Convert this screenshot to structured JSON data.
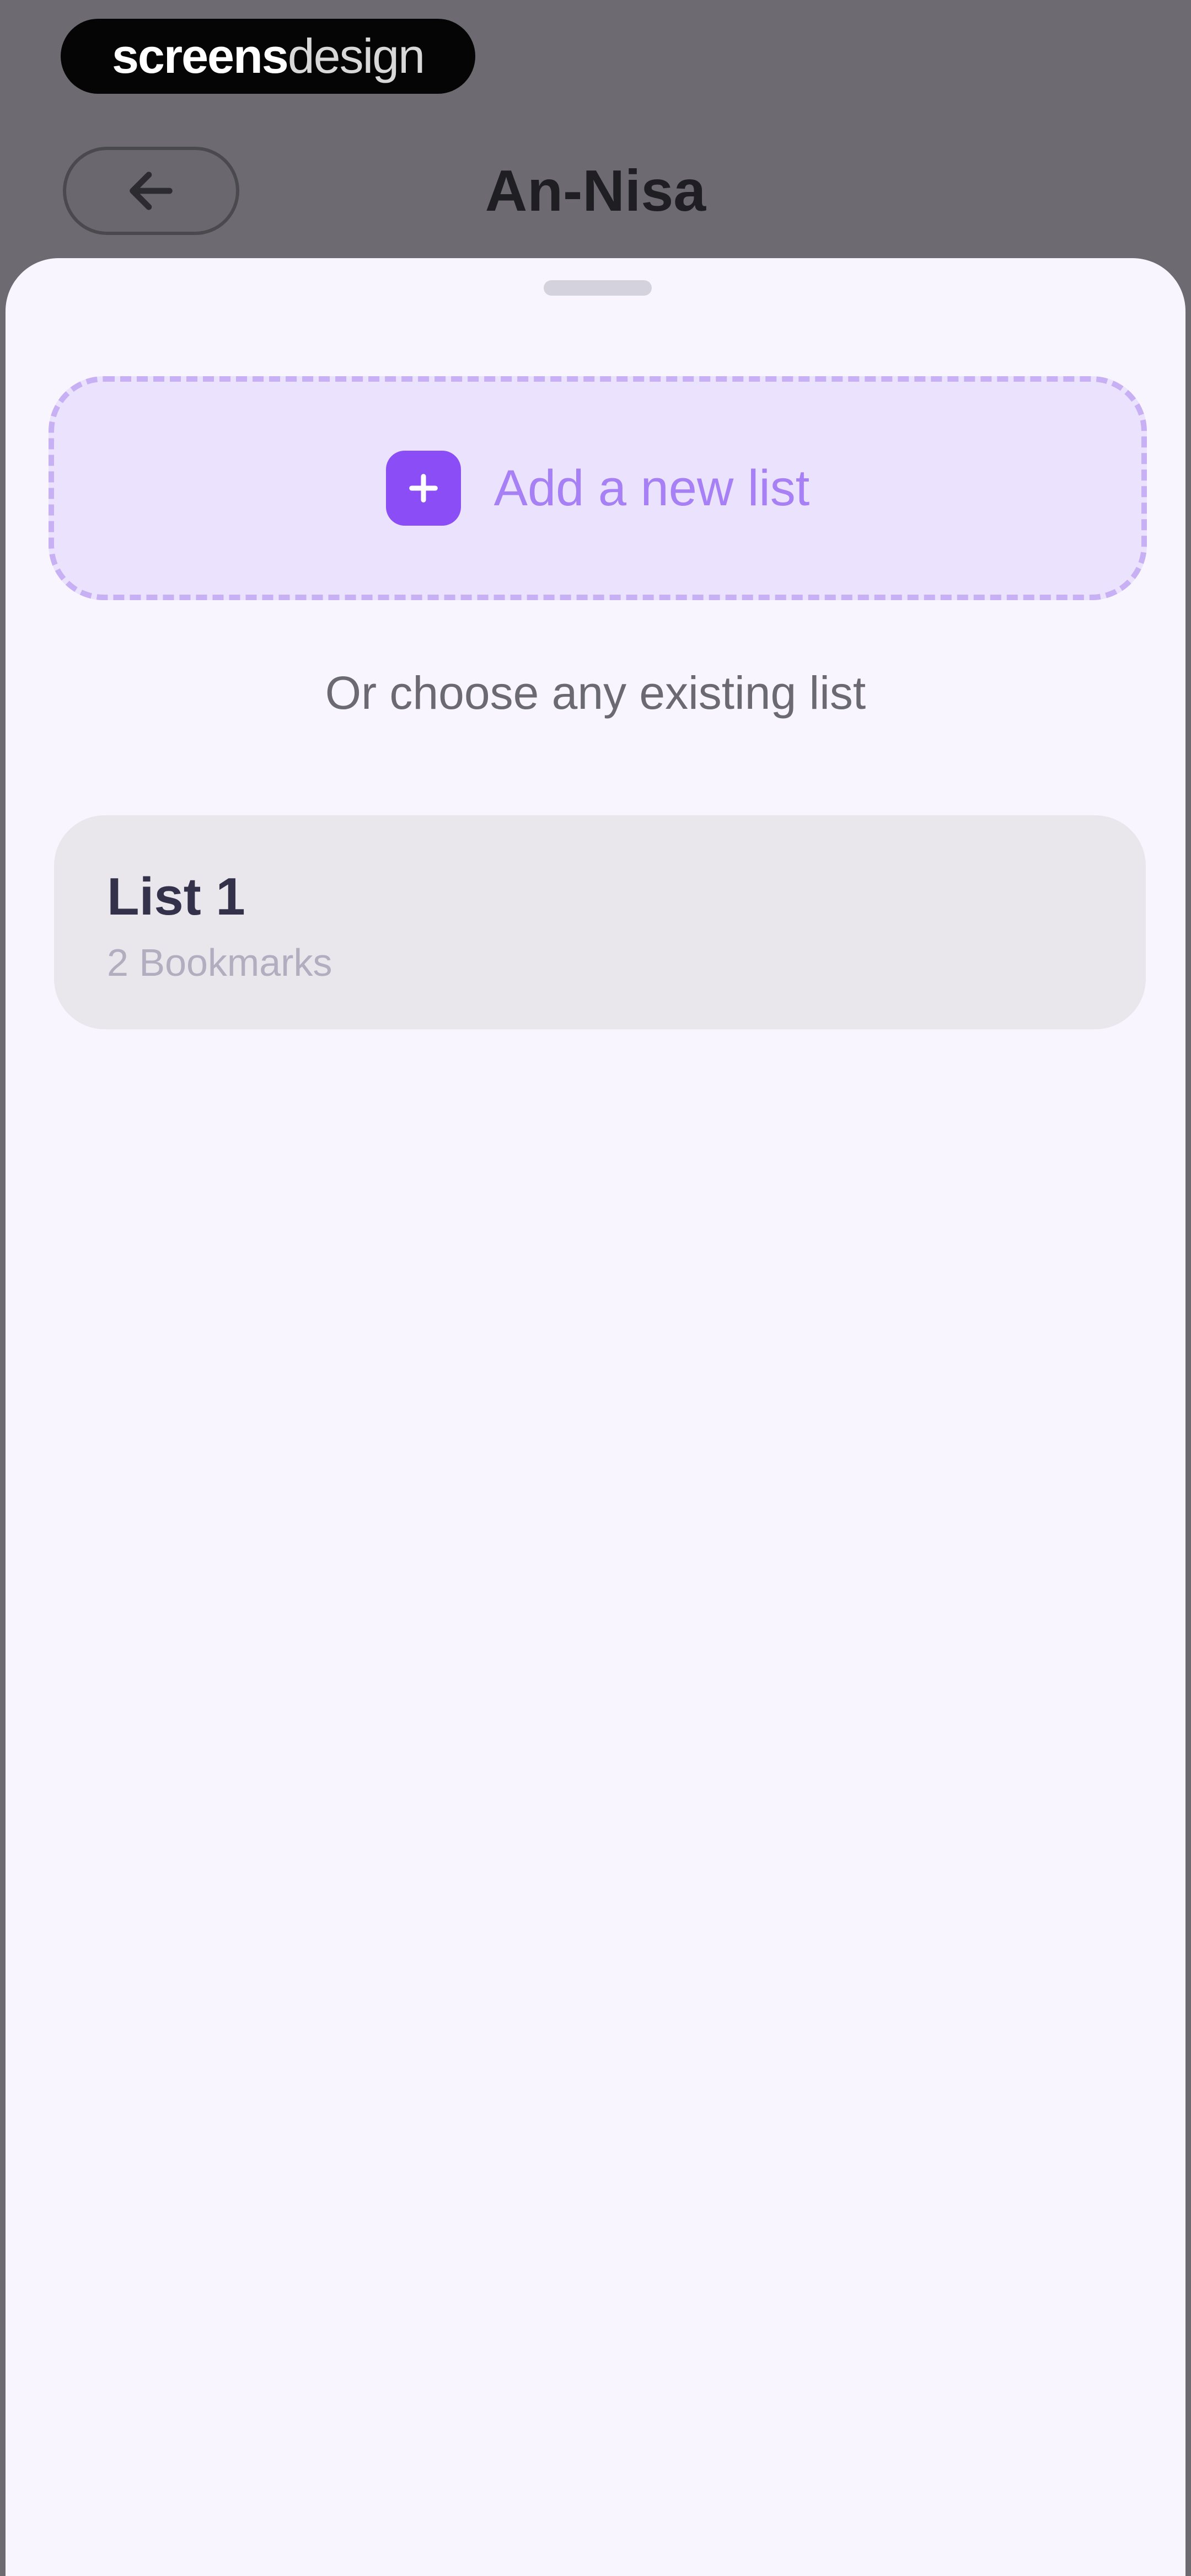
{
  "brand": {
    "strong": "screens",
    "light": "design"
  },
  "header": {
    "title": "An-Nisa"
  },
  "sheet": {
    "add_list_label": "Add a new list",
    "section_label": "Or choose any existing list",
    "lists": [
      {
        "title": "List 1",
        "subtitle": "2 Bookmarks"
      }
    ]
  },
  "colors": {
    "accent": "#8b4df5",
    "accent_light": "#ebe2fd",
    "sheet_bg": "#f8f5ff",
    "backdrop": "#6d6b71"
  },
  "icons": {
    "back": "arrow-left-icon",
    "add": "plus-icon"
  }
}
